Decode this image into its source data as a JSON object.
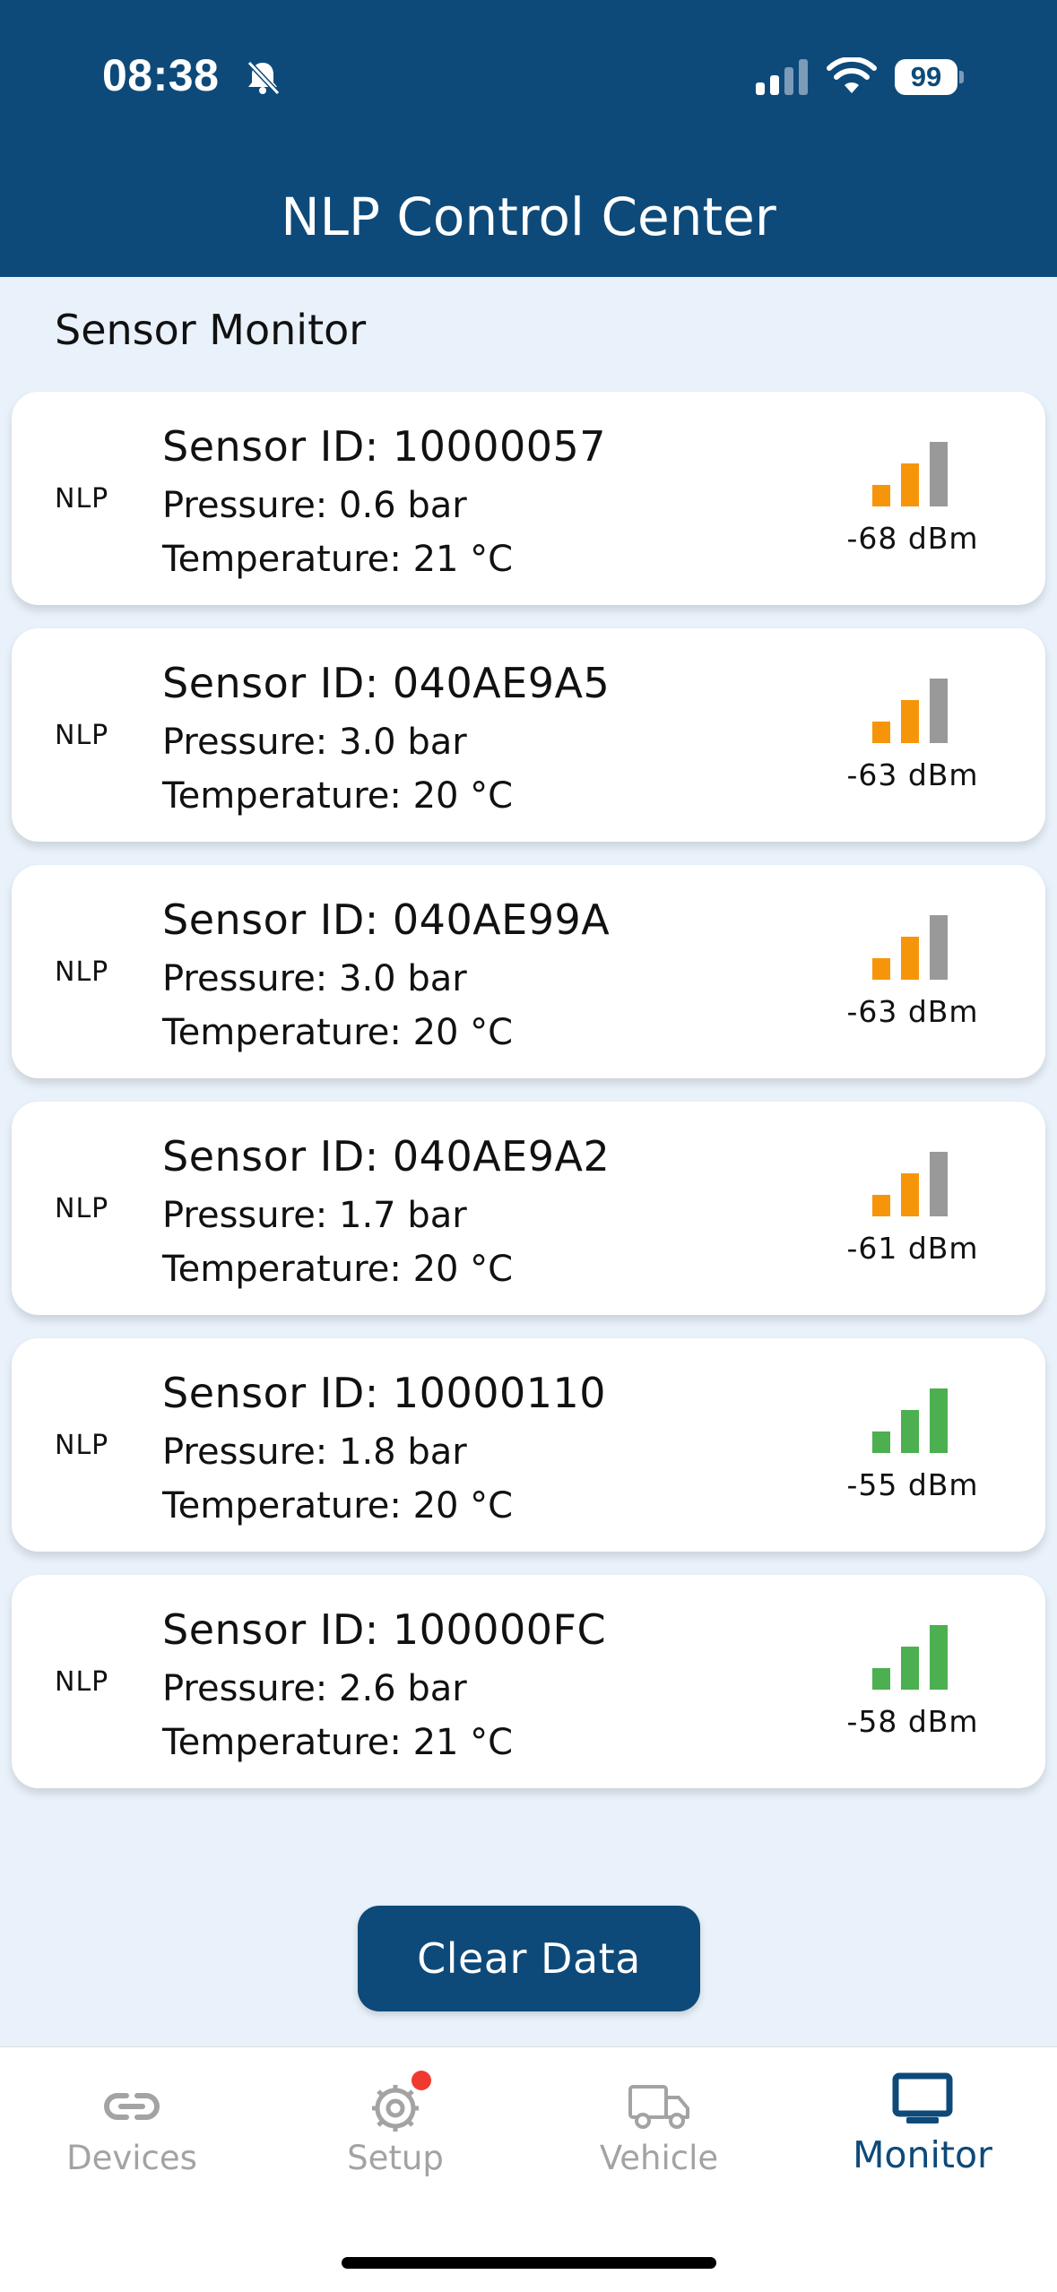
{
  "status_bar": {
    "time": "08:38",
    "battery": "99"
  },
  "app": {
    "title": "NLP Control Center"
  },
  "section_title": "Sensor Monitor",
  "sensors": [
    {
      "tag": "NLP",
      "id_text": "Sensor ID: 10000057",
      "pressure_text": "Pressure: 0.6 bar",
      "temperature_text": "Temperature: 21 °C",
      "signal": "-68 dBm",
      "signal_bars": 2,
      "color": "#f7950a"
    },
    {
      "tag": "NLP",
      "id_text": "Sensor ID: 040AE9A5",
      "pressure_text": "Pressure: 3.0 bar",
      "temperature_text": "Temperature: 20 °C",
      "signal": "-63 dBm",
      "signal_bars": 2,
      "color": "#f7950a"
    },
    {
      "tag": "NLP",
      "id_text": "Sensor ID: 040AE99A",
      "pressure_text": "Pressure: 3.0 bar",
      "temperature_text": "Temperature: 20 °C",
      "signal": "-63 dBm",
      "signal_bars": 2,
      "color": "#f7950a"
    },
    {
      "tag": "NLP",
      "id_text": "Sensor ID: 040AE9A2",
      "pressure_text": "Pressure: 1.7 bar",
      "temperature_text": "Temperature: 20 °C",
      "signal": "-61 dBm",
      "signal_bars": 2,
      "color": "#f7950a"
    },
    {
      "tag": "NLP",
      "id_text": "Sensor ID: 10000110",
      "pressure_text": "Pressure: 1.8 bar",
      "temperature_text": "Temperature: 20 °C",
      "signal": "-55 dBm",
      "signal_bars": 3,
      "color": "#4caf50"
    },
    {
      "tag": "NLP",
      "id_text": "Sensor ID: 100000FC",
      "pressure_text": "Pressure: 2.6 bar",
      "temperature_text": "Temperature: 21 °C",
      "signal": "-58 dBm",
      "signal_bars": 3,
      "color": "#4caf50"
    }
  ],
  "inactive_bar_color": "#999999",
  "clear_button": "Clear Data",
  "tabs": [
    {
      "label": "Devices",
      "icon": "link-icon"
    },
    {
      "label": "Setup",
      "icon": "gear-icon"
    },
    {
      "label": "Vehicle",
      "icon": "truck-icon"
    },
    {
      "label": "Monitor",
      "icon": "monitor-icon",
      "active": true
    }
  ]
}
